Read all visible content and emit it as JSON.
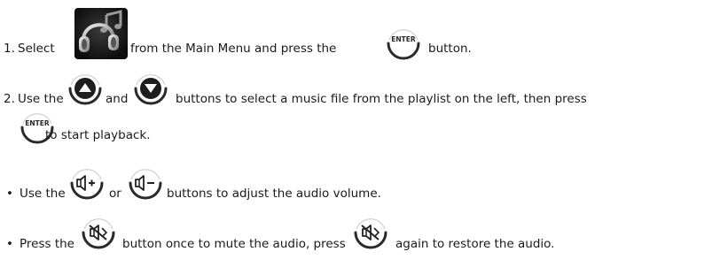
{
  "step1": {
    "number": "1.",
    "text_select": "Select",
    "text_mid": "from the Main Menu and press the",
    "text_end": "button.",
    "enter_label": "ENTER"
  },
  "step2": {
    "number": "2.",
    "text_use": "Use the",
    "text_and": "and",
    "text_mid": "buttons to select a music file from the playlist on the left, then press",
    "text_end": "to start playback.",
    "enter_label": "ENTER"
  },
  "bullet1": {
    "bullet": "•",
    "text_use": "Use the",
    "text_or": "or",
    "text_end": "buttons to adjust the audio volume."
  },
  "bullet2": {
    "bullet": "•",
    "text_press": "Press the",
    "text_mid": "button once to mute the audio, press",
    "text_end": "again to restore the audio."
  },
  "icons": {
    "music_menu": "music-headphones-icon",
    "enter": "enter-button-icon",
    "up": "up-arrow-button-icon",
    "down": "down-arrow-button-icon",
    "vol_up": "volume-up-button-icon",
    "vol_down": "volume-down-button-icon",
    "mute": "mute-button-icon"
  },
  "colors": {
    "text": "#1a1a1a",
    "button_ring": "#2a2a2a",
    "music_icon_bg": "#1c1c1c"
  }
}
